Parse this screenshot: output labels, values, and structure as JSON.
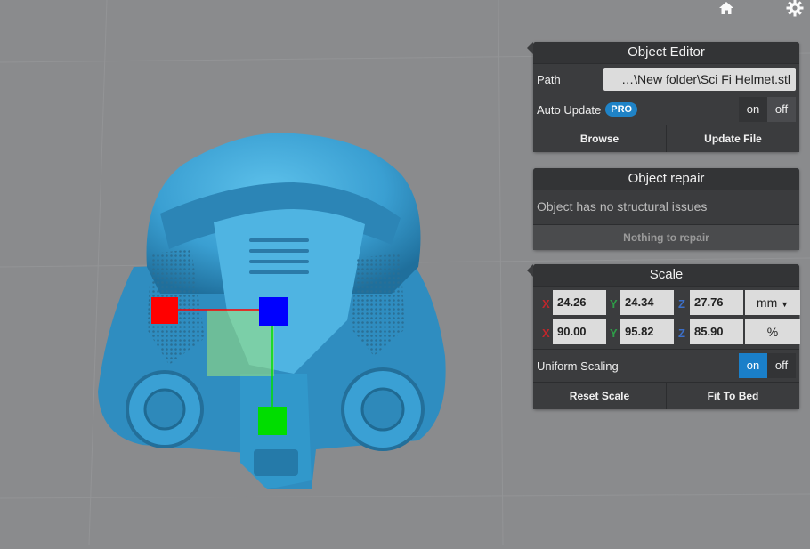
{
  "toolbar": {
    "home_icon": "home-icon",
    "settings_icon": "gear-icon"
  },
  "object_editor": {
    "title": "Object Editor",
    "path_label": "Path",
    "path_value": "…\\New folder\\Sci Fi Helmet.stl",
    "auto_update_label": "Auto Update",
    "pro_badge": "PRO",
    "toggle_on": "on",
    "toggle_off": "off",
    "browse_label": "Browse",
    "update_file_label": "Update File"
  },
  "object_repair": {
    "title": "Object repair",
    "message": "Object has no structural issues",
    "nothing_label": "Nothing to repair"
  },
  "scale": {
    "title": "Scale",
    "axis_x": "X",
    "axis_y": "Y",
    "axis_z": "Z",
    "size_x": "24.26",
    "size_y": "24.34",
    "size_z": "27.76",
    "unit": "mm",
    "pct_x": "90.00",
    "pct_y": "95.82",
    "pct_z": "85.90",
    "pct_unit": "%",
    "uniform_label": "Uniform Scaling",
    "toggle_on": "on",
    "toggle_off": "off",
    "reset_label": "Reset Scale",
    "fit_label": "Fit To Bed"
  },
  "colors": {
    "background": "#8a8b8d",
    "panel": "#3b3c3e",
    "accent": "#1a7fc9",
    "model": "#3fa6d8",
    "gizmo_x": "#ff0000",
    "gizmo_y": "#00dd00",
    "gizmo_z": "#0000ff"
  }
}
